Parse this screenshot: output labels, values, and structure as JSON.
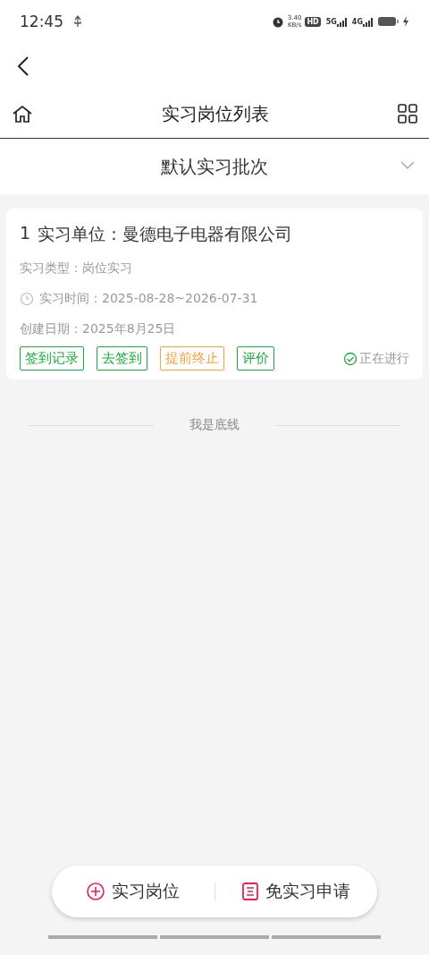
{
  "status_bar": {
    "time": "12:45",
    "speed": "3.40",
    "speed_unit": "KB/s",
    "hd": "HD",
    "network_1": "5G",
    "network_2": "4G"
  },
  "header": {
    "title": "实习岗位列表"
  },
  "batch": {
    "label": "默认实习批次",
    "expanded": false
  },
  "cards": [
    {
      "index": "1",
      "company": "实习单位：曼德电子电器有限公司",
      "type": "实习类型：岗位实习",
      "period": "实习时间：2025-08-28~2026-07-31",
      "created": "创建日期：2025年8月25日",
      "actions": [
        {
          "label": "签到记录",
          "color": "#1aad3c"
        },
        {
          "label": "去签到",
          "color": "#1aad3c"
        },
        {
          "label": "提前终止",
          "color": "#f5a33a"
        },
        {
          "label": "评价",
          "color": "#1aad3c"
        }
      ],
      "status": "正在进行"
    }
  ],
  "footer_note": "我是底线",
  "bottom_bar": {
    "items": [
      {
        "label": "实习岗位",
        "kind": "add"
      },
      {
        "label": "免实习申请",
        "kind": "form"
      }
    ]
  }
}
